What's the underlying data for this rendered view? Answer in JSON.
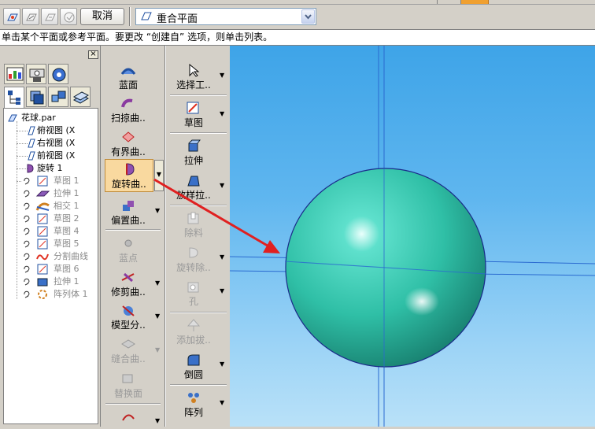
{
  "toolbar": {
    "cancel_label": "取消",
    "plane_select_value": "重合平面"
  },
  "status_text": "单击某个平面或参考平面。要更改 “创建自” 选项，则单击列表。",
  "panel": {
    "close_glyph": "×"
  },
  "tree": {
    "root": "花球.par",
    "items": [
      {
        "label": "俯视图 (X",
        "state": "normal",
        "icon": "plane-icon"
      },
      {
        "label": "右视图 (X",
        "state": "normal",
        "icon": "plane-icon"
      },
      {
        "label": "前视图 (X",
        "state": "normal",
        "icon": "plane-icon"
      },
      {
        "label": "旋转 1",
        "state": "normal",
        "icon": "revolve-icon"
      },
      {
        "label": "草图 1",
        "state": "gray",
        "icon": "sketch-icon"
      },
      {
        "label": "拉伸 1",
        "state": "gray",
        "icon": "extrude-icon"
      },
      {
        "label": "相交 1",
        "state": "gray",
        "icon": "intersect-icon"
      },
      {
        "label": "草图 2",
        "state": "gray",
        "icon": "sketch-icon"
      },
      {
        "label": "草图 4",
        "state": "gray",
        "icon": "sketch-icon"
      },
      {
        "label": "草图 5",
        "state": "gray",
        "icon": "sketch-icon"
      },
      {
        "label": "分割曲线",
        "state": "gray",
        "icon": "split-curve-icon"
      },
      {
        "label": "草图 6",
        "state": "gray",
        "icon": "sketch-icon"
      },
      {
        "label": "拉伸 1",
        "state": "gray",
        "icon": "extrude-icon"
      },
      {
        "label": "阵列体 1",
        "state": "gray",
        "icon": "pattern-icon"
      }
    ]
  },
  "col1": {
    "bluesurf": "蓝面",
    "sweep": "扫掠曲..",
    "bounded": "有界曲..",
    "revolve": "旋转曲..",
    "offset": "偏置曲..",
    "bluedot": "蓝点",
    "trim": "修剪曲..",
    "modelsplit": "模型分..",
    "stitch": "缝合曲..",
    "replace": "替换面",
    "last": "..."
  },
  "col2": {
    "select": "选择工..",
    "sketch": "草图",
    "extrude": "拉伸",
    "loft": "放样拉..",
    "cutout": "除料",
    "revcut": "旋转除..",
    "hole": "孔",
    "draft": "添加拔..",
    "round": "倒圆",
    "pattern": "阵列"
  },
  "colors": {
    "sphere": "#3cc8b4",
    "viewport_top": "#3ea4e8",
    "arrow": "#e02020",
    "highlight": "#f9d99f"
  }
}
